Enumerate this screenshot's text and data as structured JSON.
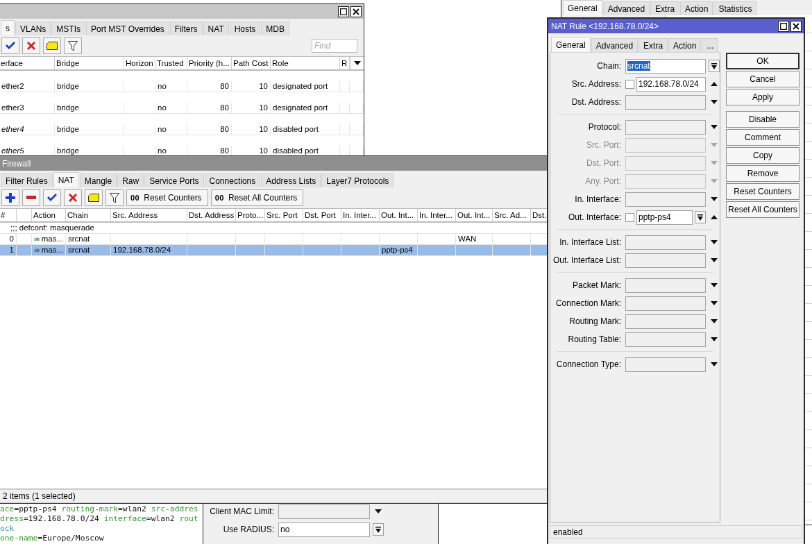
{
  "terminal": {
    "lines": [
      [
        {
          "text": "ace",
          "kind": "key"
        },
        {
          "text": "=pptp-ps4 ",
          "kind": "value"
        },
        {
          "text": "routing-mark",
          "kind": "key"
        },
        {
          "text": "=wlan2 ",
          "kind": "value"
        },
        {
          "text": "src-addres",
          "kind": "key"
        }
      ],
      [
        {
          "text": "dress",
          "kind": "key"
        },
        {
          "text": "=192.168.78.0/24 ",
          "kind": "value"
        },
        {
          "text": "interface",
          "kind": "key"
        },
        {
          "text": "=wlan2 ",
          "kind": "value"
        },
        {
          "text": "rout",
          "kind": "key"
        }
      ],
      [
        {
          "text": "ock",
          "kind": "command"
        }
      ],
      [
        {
          "text": "one-name",
          "kind": "key"
        },
        {
          "text": "=Europe/Moscow",
          "kind": "value"
        }
      ]
    ]
  },
  "back_window": {
    "tabs": [
      {
        "label": "General",
        "selected": true
      },
      {
        "label": "Advanced",
        "selected": false
      },
      {
        "label": "Extra",
        "selected": false
      },
      {
        "label": "Action",
        "selected": false
      },
      {
        "label": "Statistics",
        "selected": false
      }
    ]
  },
  "wireless_window": {
    "rows": [
      {
        "label": "Client MAC Limit:",
        "kind": "optional",
        "disabled": false
      },
      {
        "label": "Use RADIUS:",
        "kind": "select",
        "value": "no",
        "value_selected": false
      }
    ]
  },
  "bridge_window": {
    "tabs": [
      {
        "label": "s",
        "selected": true
      },
      {
        "label": "VLANs",
        "selected": false
      },
      {
        "label": "MSTIs",
        "selected": false
      },
      {
        "label": "Port MST Overrides",
        "selected": false
      },
      {
        "label": "Filters",
        "selected": false
      },
      {
        "label": "NAT",
        "selected": false
      },
      {
        "label": "Hosts",
        "selected": false
      },
      {
        "label": "MDB",
        "selected": false
      }
    ],
    "toolbar": [
      {
        "kind": "enable"
      },
      {
        "kind": "disable"
      },
      {
        "kind": "comment"
      },
      {
        "kind": "filter"
      }
    ],
    "find": {
      "placeholder": "Find"
    },
    "columns": [
      "erface",
      "Bridge",
      "Horizon",
      "Trusted",
      "Priority (h...",
      "Path Cost",
      "Role",
      "R"
    ],
    "rows": [
      {
        "disabled": false,
        "cells": [
          "ether2",
          "bridge",
          null,
          "no",
          "80",
          "10",
          "designated port",
          null
        ]
      },
      {
        "disabled": false,
        "cells": [
          "ether3",
          "bridge",
          null,
          "no",
          "80",
          "10",
          "designated port",
          null
        ]
      },
      {
        "disabled": true,
        "cells": [
          "ether4",
          "bridge",
          null,
          "no",
          "80",
          "10",
          "disabled port",
          null
        ]
      },
      {
        "disabled": true,
        "cells": [
          "ether5",
          "bridge",
          null,
          "no",
          "80",
          "10",
          "disabled port",
          null
        ]
      }
    ]
  },
  "firewall": {
    "title": "Firewall",
    "tabs": [
      {
        "label": "Filter Rules",
        "selected": false
      },
      {
        "label": "NAT",
        "selected": true
      },
      {
        "label": "Mangle",
        "selected": false
      },
      {
        "label": "Raw",
        "selected": false
      },
      {
        "label": "Service Ports",
        "selected": false
      },
      {
        "label": "Connections",
        "selected": false
      },
      {
        "label": "Address Lists",
        "selected": false
      },
      {
        "label": "Layer7 Protocols",
        "selected": false
      }
    ],
    "toolbar": [
      {
        "kind": "add"
      },
      {
        "kind": "remove"
      },
      {
        "kind": "enable"
      },
      {
        "kind": "disable"
      },
      {
        "kind": "comment"
      },
      {
        "kind": "filter"
      },
      {
        "kind": "counter",
        "prefix": "00",
        "label": "Reset Counters"
      },
      {
        "kind": "counter",
        "prefix": "00",
        "label": "Reset All Counters"
      }
    ],
    "columns": [
      "#",
      null,
      "Action",
      "Chain",
      "Src. Address",
      "Dst. Address",
      "Proto...",
      "Src. Port",
      "Dst. Port",
      "In. Inter...",
      "Out. Int...",
      "In. Inter...",
      "Out. Int...",
      "Src. Ad...",
      "Dst."
    ],
    "rows": [
      {
        "kind": "comment",
        "text": ";;; defconf: masquerade"
      },
      {
        "kind": "rule",
        "selected": false,
        "cells": [
          "0",
          null,
          "mas...",
          "srcnat",
          null,
          null,
          null,
          null,
          null,
          null,
          null,
          null,
          "WAN",
          null,
          null
        ]
      },
      {
        "kind": "rule",
        "selected": true,
        "cells": [
          "1",
          null,
          "mas...",
          "srcnat",
          "192.168.78.0/24",
          null,
          null,
          null,
          null,
          null,
          "pptp-ps4",
          null,
          null,
          null,
          null
        ]
      }
    ],
    "status": "2 items (1 selected)"
  },
  "nat_rule": {
    "title": "NAT Rule <192.168.78.0/24>",
    "tabs": [
      {
        "label": "General",
        "selected": true
      },
      {
        "label": "Advanced",
        "selected": false
      },
      {
        "label": "Extra",
        "selected": false
      },
      {
        "label": "Action",
        "selected": false
      },
      {
        "label": "...",
        "selected": false
      }
    ],
    "groups": [
      [
        {
          "label": "Chain:",
          "kind": "select",
          "value": "srcnat",
          "value_selected": true
        },
        {
          "label": "Src. Address:",
          "kind": "negatable",
          "negate": false,
          "value": "192.168.78.0/24"
        },
        {
          "label": "Dst. Address:",
          "kind": "optional",
          "disabled": false
        }
      ],
      [
        {
          "label": "Protocol:",
          "kind": "optional",
          "disabled": false
        },
        {
          "label": "Src. Port:",
          "kind": "optional",
          "disabled": true
        },
        {
          "label": "Dst. Port:",
          "kind": "optional",
          "disabled": true
        },
        {
          "label": "Any. Port:",
          "kind": "optional",
          "disabled": true
        },
        {
          "label": "In. Interface:",
          "kind": "optional",
          "disabled": false
        },
        {
          "label": "Out. Interface:",
          "kind": "negatable-select",
          "negate": false,
          "value": "pptp-ps4"
        }
      ],
      [
        {
          "label": "In. Interface List:",
          "kind": "optional",
          "disabled": false
        },
        {
          "label": "Out. Interface List:",
          "kind": "optional",
          "disabled": false
        }
      ],
      [
        {
          "label": "Packet Mark:",
          "kind": "optional",
          "disabled": false
        },
        {
          "label": "Connection Mark:",
          "kind": "optional",
          "disabled": false
        },
        {
          "label": "Routing Mark:",
          "kind": "optional",
          "disabled": false
        },
        {
          "label": "Routing Table:",
          "kind": "optional",
          "disabled": false
        }
      ],
      [
        {
          "label": "Connection Type:",
          "kind": "optional",
          "disabled": false
        }
      ]
    ],
    "buttons": [
      [
        {
          "label": "OK",
          "default": true
        },
        {
          "label": "Cancel",
          "default": false
        },
        {
          "label": "Apply",
          "default": false
        }
      ],
      [
        {
          "label": "Disable",
          "default": false
        },
        {
          "label": "Comment",
          "default": false
        },
        {
          "label": "Copy",
          "default": false
        },
        {
          "label": "Remove",
          "default": false
        },
        {
          "label": "Reset Counters",
          "default": false
        },
        {
          "label": "Reset All Counters",
          "default": false
        }
      ]
    ],
    "status": "enabled"
  }
}
